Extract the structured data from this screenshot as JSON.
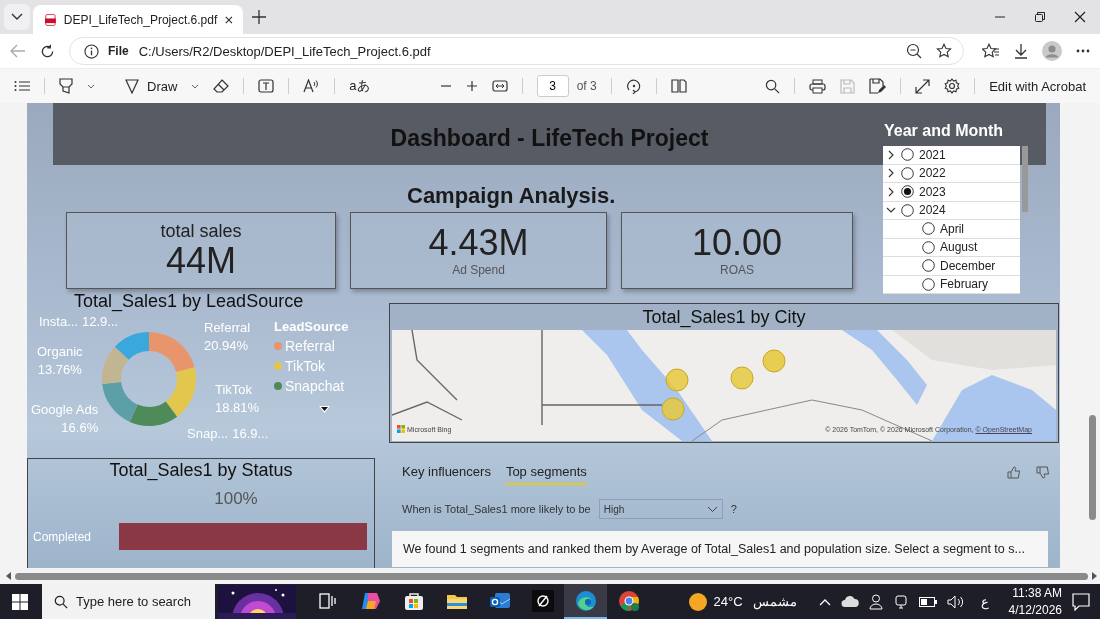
{
  "browser": {
    "tab": {
      "title": "DEPI_LifeTech_Project.6.pdf"
    },
    "address": {
      "scheme": "File",
      "url": "C:/Users/R2/Desktop/DEPI_LifeTech_Project.6.pdf"
    }
  },
  "pdf_toolbar": {
    "draw_label": "Draw",
    "translate_label": "aあ",
    "page": "3",
    "page_count": "of 3",
    "save_disabled": true,
    "edit_label": "Edit with Acrobat"
  },
  "report": {
    "title": "Dashboard - LifeTech Project",
    "subtitle": "Campaign Analysis.",
    "cards": [
      {
        "kind": "label-top",
        "label": "total sales",
        "value": "44M"
      },
      {
        "kind": "label-bottom",
        "label": "Ad Spend",
        "value": "4.43M"
      },
      {
        "kind": "label-bottom",
        "label": "ROAS",
        "value": "10.00"
      }
    ],
    "slicer": {
      "title": "Year and Month",
      "items": [
        {
          "label": "2021",
          "selected": false,
          "expanded": false
        },
        {
          "label": "2022",
          "selected": false,
          "expanded": false
        },
        {
          "label": "2023",
          "selected": true,
          "expanded": false
        },
        {
          "label": "2024",
          "selected": false,
          "expanded": true,
          "children": [
            {
              "label": "April",
              "selected": false
            },
            {
              "label": "August",
              "selected": false
            },
            {
              "label": "December",
              "selected": false
            },
            {
              "label": "February",
              "selected": false
            }
          ]
        }
      ]
    },
    "donut": {
      "chart_data": {
        "type": "donut",
        "title": "Total_Sales1 by LeadSource",
        "categories": [
          "Referral",
          "TikTok",
          "Snap...",
          "Google Ads",
          "Organic",
          "Insta..."
        ],
        "values": [
          20.94,
          18.81,
          16.9,
          16.6,
          13.76,
          12.9
        ],
        "colors": [
          "#e8956b",
          "#e3c64c",
          "#4f8a59",
          "#5c9fa6",
          "#c2b592",
          "#3aa8dc"
        ],
        "value_labels": [
          "20.94%",
          "18.81%",
          "16.9...",
          "16.6%",
          "13.76%",
          "12.9..."
        ]
      },
      "legend": {
        "title": "LeadSource",
        "items": [
          {
            "label": "Referral",
            "color": "#e8956b"
          },
          {
            "label": "TikTok",
            "color": "#e3c64c"
          },
          {
            "label": "Snapchat",
            "color": "#4f8a59"
          }
        ]
      }
    },
    "map": {
      "title": "Total_Sales1 by City",
      "provider": "Microsoft Bing",
      "attribution": "© 2026 TomTom, © 2026 Microsoft Corporation,",
      "attribution_link": "© OpenStreetMap"
    },
    "status": {
      "title": "Total_Sales1 by Status",
      "scale_label": "100%",
      "bars": [
        {
          "label": "Completed"
        }
      ]
    },
    "influencers": {
      "tabs": [
        {
          "label": "Key influencers",
          "selected": false
        },
        {
          "label": "Top segments",
          "selected": true
        }
      ],
      "question": "When is Total_Sales1 more likely to be",
      "target": "High",
      "help": "?",
      "message": "We found 1 segments and ranked them by Average of Total_Sales1 and population size. Select a segment to s..."
    }
  },
  "taskbar": {
    "search": {
      "placeholder": "Type here to search"
    },
    "apps": [
      {
        "kind": "task-view",
        "selected": false
      },
      {
        "kind": "copilot",
        "selected": false
      },
      {
        "kind": "store",
        "selected": false
      },
      {
        "kind": "folder",
        "selected": false
      },
      {
        "kind": "mail",
        "selected": false
      },
      {
        "kind": "dark-app",
        "selected": false
      },
      {
        "kind": "edge",
        "selected": true
      },
      {
        "kind": "chrome",
        "selected": false
      }
    ],
    "weather": {
      "temperature": "24°C",
      "condition": "مشمس"
    },
    "language": "ع",
    "time": "11:38 AM",
    "date": "4/12/2026"
  }
}
